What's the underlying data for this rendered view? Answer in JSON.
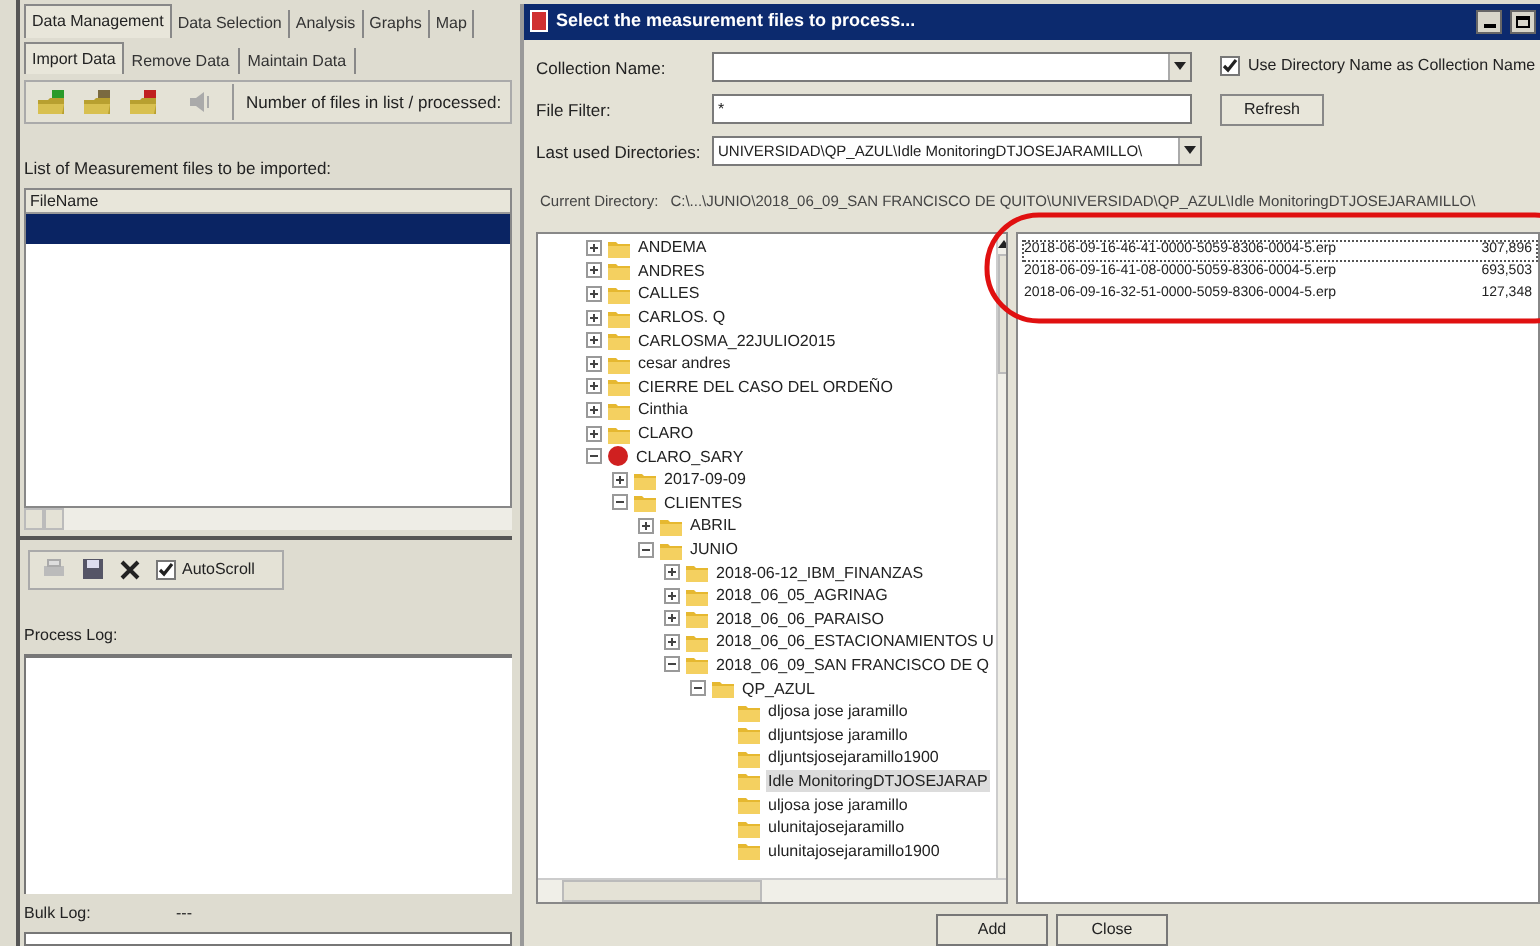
{
  "main_window": {
    "tabs": [
      {
        "label": "Data Management",
        "selected": true
      },
      {
        "label": "Data Selection",
        "selected": false
      },
      {
        "label": "Analysis",
        "selected": false
      },
      {
        "label": "Graphs",
        "selected": false
      },
      {
        "label": "Map",
        "selected": false
      }
    ],
    "subtabs": [
      {
        "label": "Import Data",
        "selected": true
      },
      {
        "label": "Remove Data",
        "selected": false
      },
      {
        "label": "Maintain Data",
        "selected": false
      }
    ],
    "files_count_label": "Number of files in list / processed:",
    "file_list": {
      "label": "List of Measurement files to be imported:",
      "column": "FileName",
      "rows": [
        {
          "selected": true
        }
      ]
    },
    "autoscroll": {
      "label": "AutoScroll",
      "checked": true
    },
    "process_log": {
      "label": "Process Log:"
    },
    "bulk_log": {
      "label": "Bulk Log:",
      "value": "---"
    }
  },
  "dialog": {
    "title": "Select the measurement files to process...",
    "collection_name": {
      "label": "Collection Name:"
    },
    "file_filter": {
      "label": "File Filter:",
      "value": "*"
    },
    "last_used": {
      "label": "Last used Directories:",
      "value": "UNIVERSIDAD\\QP_AZUL\\Idle MonitoringDTJOSEJARAMILLO\\"
    },
    "use_directory_name": {
      "label": "Use Directory Name as Collection Name",
      "checked": true
    },
    "refresh": "Refresh",
    "current_directory": {
      "label": "Current Directory:",
      "value": "C:\\...\\JUNIO\\2018_06_09_SAN FRANCISCO DE QUITO\\UNIVERSIDAD\\QP_AZUL\\Idle MonitoringDTJOSEJARAMILLO\\"
    },
    "tree": [
      {
        "label": "ANDEMA",
        "kind": "folder",
        "expanded": false,
        "selected": false
      },
      {
        "label": "ANDRES",
        "kind": "folder",
        "expanded": false,
        "selected": false
      },
      {
        "label": "CALLES",
        "kind": "folder",
        "expanded": false,
        "selected": false
      },
      {
        "label": "CARLOS. Q",
        "kind": "folder",
        "expanded": false,
        "selected": false
      },
      {
        "label": "CARLOSMA_22JULIO2015",
        "kind": "folder",
        "expanded": false,
        "selected": false
      },
      {
        "label": "cesar andres",
        "kind": "folder",
        "expanded": false,
        "selected": false
      },
      {
        "label": "CIERRE DEL CASO DEL ORDEÑO",
        "kind": "folder",
        "expanded": false,
        "selected": false
      },
      {
        "label": "Cinthia",
        "kind": "folder",
        "expanded": false,
        "selected": false
      },
      {
        "label": "CLARO",
        "kind": "folder",
        "expanded": false,
        "selected": false
      },
      {
        "label": "CLARO_SARY",
        "kind": "restricted",
        "expanded": true,
        "selected": false,
        "children": [
          {
            "label": "2017-09-09",
            "kind": "folder",
            "expanded": false,
            "selected": false
          },
          {
            "label": "CLIENTES",
            "kind": "folder",
            "expanded": true,
            "selected": false,
            "children": [
              {
                "label": "ABRIL",
                "kind": "folder",
                "expanded": false,
                "selected": false
              },
              {
                "label": "JUNIO",
                "kind": "folder",
                "expanded": true,
                "selected": false,
                "children": [
                  {
                    "label": "2018-06-12_IBM_FINANZAS",
                    "kind": "folder",
                    "expanded": false,
                    "selected": false
                  },
                  {
                    "label": "2018_06_05_AGRINAG",
                    "kind": "folder",
                    "expanded": false,
                    "selected": false
                  },
                  {
                    "label": "2018_06_06_PARAISO",
                    "kind": "folder",
                    "expanded": false,
                    "selected": false
                  },
                  {
                    "label": "2018_06_06_ESTACIONAMIENTOS U",
                    "kind": "folder",
                    "expanded": false,
                    "selected": false
                  },
                  {
                    "label": "2018_06_09_SAN FRANCISCO DE Q",
                    "kind": "folder",
                    "expanded": true,
                    "selected": false,
                    "children": [
                      {
                        "label": "QP_AZUL",
                        "kind": "folder",
                        "expanded": true,
                        "selected": false,
                        "children": [
                          {
                            "label": "dljosa jose jaramillo",
                            "kind": "folder",
                            "selected": false
                          },
                          {
                            "label": "dljuntsjose jaramillo",
                            "kind": "folder",
                            "selected": false
                          },
                          {
                            "label": "dljuntsjosejaramillo1900",
                            "kind": "folder",
                            "selected": false
                          },
                          {
                            "label": "Idle MonitoringDTJOSEJARAP",
                            "kind": "folder",
                            "selected": true
                          },
                          {
                            "label": "uljosa jose jaramillo",
                            "kind": "folder",
                            "selected": false
                          },
                          {
                            "label": "ulunitajosejaramillo",
                            "kind": "folder",
                            "selected": false
                          },
                          {
                            "label": "ulunitajosejaramillo1900",
                            "kind": "folder",
                            "selected": false
                          }
                        ]
                      }
                    ]
                  }
                ]
              }
            ]
          }
        ]
      }
    ],
    "files": [
      {
        "name": "2018-06-09-16-46-41-0000-5059-8306-0004-5.erp",
        "size": "307,896",
        "selected": true
      },
      {
        "name": "2018-06-09-16-41-08-0000-5059-8306-0004-5.erp",
        "size": "693,503",
        "selected": false
      },
      {
        "name": "2018-06-09-16-32-51-0000-5059-8306-0004-5.erp",
        "size": "127,348",
        "selected": false
      }
    ],
    "buttons": [
      "Add",
      "Close"
    ]
  }
}
